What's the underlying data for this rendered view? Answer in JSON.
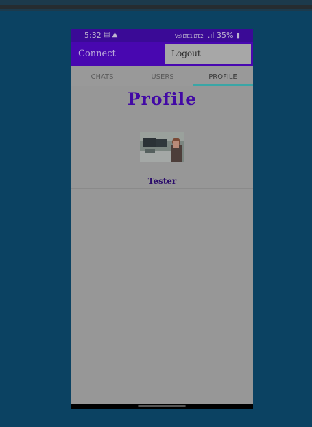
{
  "status_bar": {
    "time": "5:32",
    "left_icons": "▤ ▲",
    "network": "Vo) LTE1 LTE2",
    "signal": ".ıl",
    "battery": "35%"
  },
  "app_bar": {
    "title": "Connect",
    "logout_label": "Logout"
  },
  "tabs": [
    {
      "label": "CHATS",
      "active": false
    },
    {
      "label": "USERS",
      "active": false
    },
    {
      "label": "PROFILE",
      "active": true
    }
  ],
  "profile": {
    "heading": "Profile",
    "name": "Tester"
  },
  "colors": {
    "app_bar": "#4807b0",
    "status_bar": "#3a0a96",
    "tab_indicator": "#3aa6a6",
    "heading": "#4209a5"
  }
}
